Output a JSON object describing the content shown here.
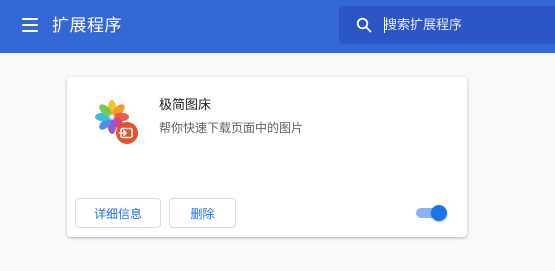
{
  "header": {
    "title": "扩展程序",
    "search": {
      "placeholder": "搜索扩展程序",
      "value": ""
    }
  },
  "extensions": [
    {
      "name": "极简图床",
      "description": "帮你快速下载页面中的图片",
      "details_label": "详细信息",
      "remove_label": "删除",
      "enabled": true,
      "icon": "photos-flower-icon"
    }
  ],
  "colors": {
    "topbar": "#3367d6",
    "search_bg": "#2a56c6",
    "accent": "#1a73e8",
    "toggle_track": "#8ab4f8",
    "background": "#f8f9fa"
  }
}
